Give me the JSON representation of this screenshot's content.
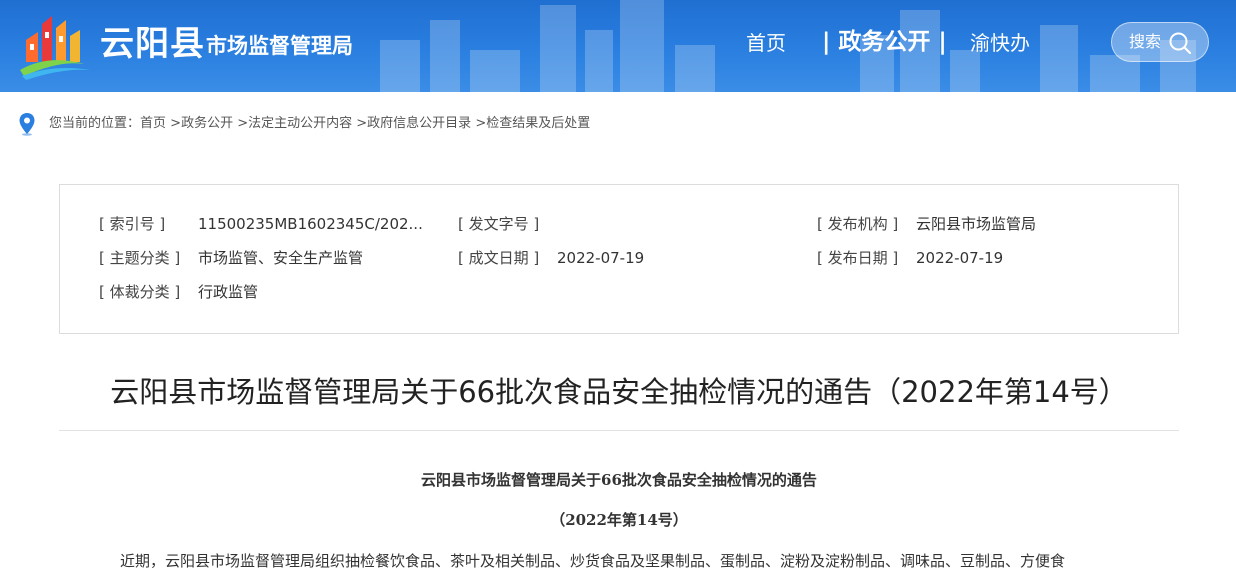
{
  "header": {
    "logo_main": "云阳县",
    "logo_sub": "市场监督管理局",
    "nav": [
      {
        "label": "首页"
      },
      {
        "label": "| 政务公开 |"
      },
      {
        "label": "渝快办"
      }
    ],
    "search_label": "搜索",
    "colors": {
      "bar": "#2a7fe0",
      "text": "#ffffff"
    }
  },
  "breadcrumb": {
    "prefix": "您当前的位置：",
    "items": [
      "首页",
      ">政务公开",
      ">法定主动公开内容",
      ">政府信息公开目录",
      ">检查结果及后处置"
    ]
  },
  "meta": {
    "index_no_label": "[ 索引号 ]",
    "index_no_value": "11500235MB1602345C/202...",
    "doc_no_label": "[ 发文字号 ]",
    "doc_no_value": "",
    "issuer_label": "[ 发布机构 ]",
    "issuer_value": "云阳县市场监管局",
    "topic_label": "[ 主题分类 ]",
    "topic_value": "市场监管、安全生产监管",
    "created_label": "[ 成文日期 ]",
    "created_value": "2022-07-19",
    "published_label": "[ 发布日期 ]",
    "published_value": "2022-07-19",
    "genre_label": "[ 体裁分类 ]",
    "genre_value": "行政监管"
  },
  "document": {
    "title": "云阳县市场监督管理局关于66批次食品安全抽检情况的通告（2022年第14号）",
    "article_title": "云阳县市场监督管理局关于66批次食品安全抽检情况的通告",
    "article_sub": "（2022年第14号）",
    "paragraph": "近期，云阳县市场监督管理局组织抽检餐饮食品、茶叶及相关制品、炒货食品及坚果制品、蛋制品、淀粉及淀粉制品、调味品、豆制品、方便食"
  }
}
